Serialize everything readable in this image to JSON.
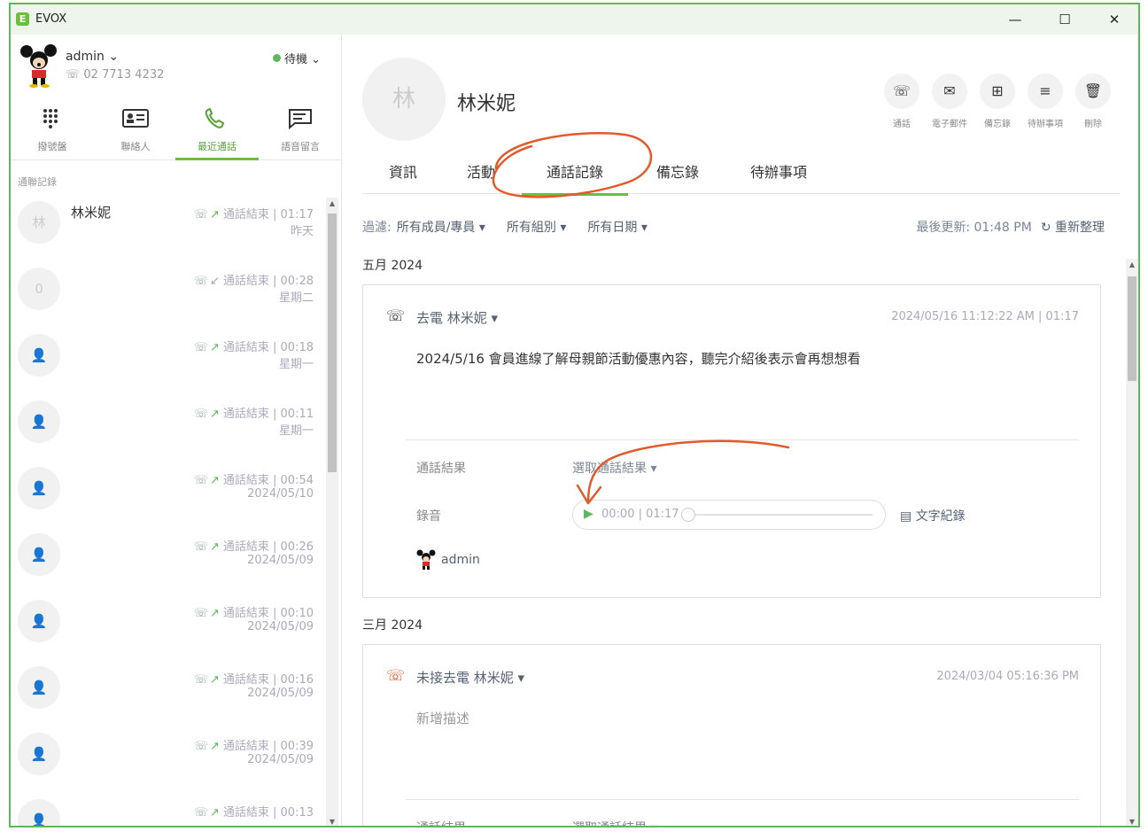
{
  "app": {
    "title": "EVOX",
    "logo_letter": "E"
  },
  "window_controls": {
    "minimize": "—",
    "maximize": "☐",
    "close": "✕"
  },
  "user": {
    "name": "admin",
    "phone": "02 7713 4232",
    "status": "待機"
  },
  "nav": [
    {
      "label": "撥號盤",
      "icon": "dialpad-icon"
    },
    {
      "label": "聯絡人",
      "icon": "contact-card-icon"
    },
    {
      "label": "最近通話",
      "icon": "phone-icon",
      "active": true
    },
    {
      "label": "語音留言",
      "icon": "voicemail-icon"
    }
  ],
  "recent": {
    "section_title": "通聯記錄",
    "calls": [
      {
        "avatar": "林",
        "name": "林米妮",
        "direction": "out",
        "status": "通話結束 | 01:17",
        "time": "昨天"
      },
      {
        "avatar": "0",
        "name": "",
        "direction": "in",
        "status": "通話結束 | 00:28",
        "time": "星期二"
      },
      {
        "avatar": "",
        "name": "",
        "direction": "out",
        "status": "通話結束 | 00:18",
        "time": "星期一"
      },
      {
        "avatar": "",
        "name": "",
        "direction": "out",
        "status": "通話結束 | 00:11",
        "time": "星期一"
      },
      {
        "avatar": "",
        "name": "",
        "direction": "out",
        "status": "通話結束 | 00:54",
        "time": "2024/05/10"
      },
      {
        "avatar": "",
        "name": "",
        "direction": "out",
        "status": "通話結束 | 00:26",
        "time": "2024/05/09"
      },
      {
        "avatar": "",
        "name": "",
        "direction": "out",
        "status": "通話結束 | 00:10",
        "time": "2024/05/09"
      },
      {
        "avatar": "",
        "name": "",
        "direction": "out",
        "status": "通話結束 | 00:16",
        "time": "2024/05/09"
      },
      {
        "avatar": "",
        "name": "",
        "direction": "out",
        "status": "通話結束 | 00:39",
        "time": "2024/05/09"
      },
      {
        "avatar": "",
        "name": "",
        "direction": "out",
        "status": "通話結束 | 00:13",
        "time": ""
      }
    ]
  },
  "contact": {
    "avatar": "林",
    "name": "林米妮"
  },
  "actions": [
    {
      "label": "通話",
      "icon": "phone-icon",
      "glyph": "☏"
    },
    {
      "label": "電子郵件",
      "icon": "mail-icon",
      "glyph": "✉"
    },
    {
      "label": "備忘錄",
      "icon": "note-add-icon",
      "glyph": "⊞"
    },
    {
      "label": "待辦事項",
      "icon": "todo-add-icon",
      "glyph": "≡"
    },
    {
      "label": "刪除",
      "icon": "trash-icon",
      "glyph": "🗑"
    }
  ],
  "tabs": [
    {
      "label": "資訊"
    },
    {
      "label": "活動"
    },
    {
      "label": "通話記錄",
      "active": true
    },
    {
      "label": "備忘錄"
    },
    {
      "label": "待辦事項"
    }
  ],
  "filter": {
    "label": "過濾:",
    "members": "所有成員/專員 ▾",
    "groups": "所有組別 ▾",
    "dates": "所有日期 ▾",
    "updated": "最後更新: 01:48 PM",
    "refresh": "↻ 重新整理"
  },
  "feed": {
    "months": [
      "五月 2024",
      "三月 2024"
    ],
    "entries": [
      {
        "title": "去電 林米妮 ▾",
        "stamp": "2024/05/16 11:12:22 AM | 01:17",
        "description": "2024/5/16 會員進線了解母親節活動優惠內容，聽完介紹後表示會再想想看",
        "result_label": "通話結果",
        "result_value": "選取通話結果 ▾",
        "recording_label": "錄音",
        "player_time": "00:00 | 01:17",
        "player_progress": 0,
        "transcript": "文字紀錄",
        "owner": "admin"
      },
      {
        "title": "未接去電 林米妮 ▾",
        "stamp": "2024/03/04 05:16:36 PM",
        "description": "新增描述",
        "result_label": "通話結果",
        "result_value": "選取通話結果 ▾"
      }
    ]
  },
  "colors": {
    "accent": "#6cbf3c",
    "missed": "#e8562a",
    "annotation": "#e05a2b",
    "frame": "#5cb85c"
  }
}
